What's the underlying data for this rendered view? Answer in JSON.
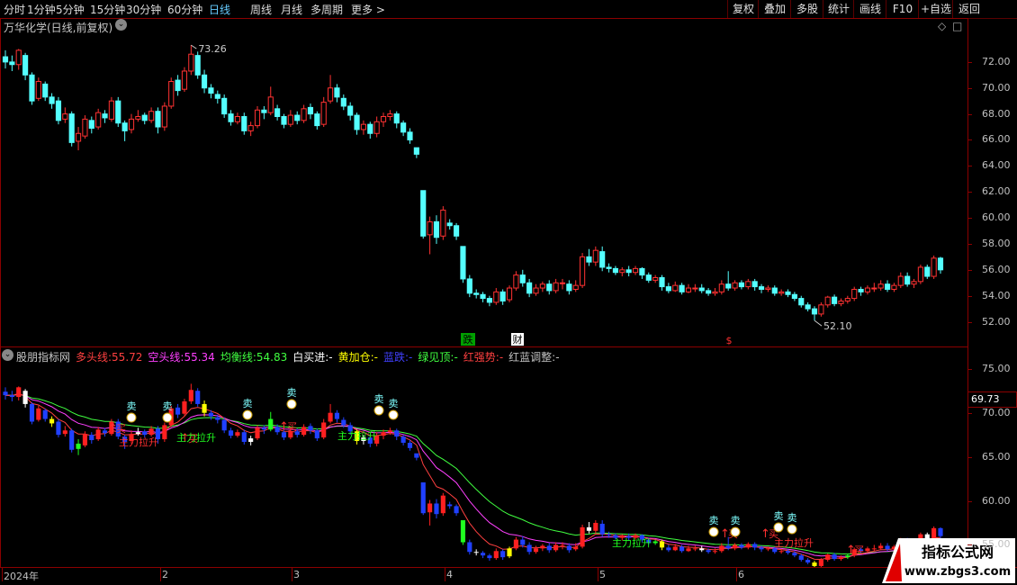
{
  "toolbar": {
    "periods": [
      "分时",
      "1分钟",
      "5分钟",
      "15分钟",
      "30分钟",
      "60分钟",
      "日线",
      "周线",
      "月线",
      "多周期",
      "更多 >"
    ],
    "active_period": "日线",
    "right_buttons": [
      "复权",
      "叠加",
      "多股",
      "统计",
      "画线",
      "F10",
      "+自选",
      "返回"
    ]
  },
  "main_title": "万华化学(日线,前复权)",
  "main_corner_icons": [
    "◇",
    "□"
  ],
  "main_markers": {
    "fall": "跌",
    "report": "财",
    "event": "$"
  },
  "high_label": "73.26",
  "low_label": "52.10",
  "price_badge": "69.73",
  "indicator": {
    "name": "股朋指标网",
    "legend": [
      {
        "label": "多头线:",
        "value": "55.72",
        "color": "#ff4040"
      },
      {
        "label": "空头线:",
        "value": "55.34",
        "color": "#ff40ff"
      },
      {
        "label": "均衡线:",
        "value": "54.83",
        "color": "#40ff40"
      },
      {
        "label": "白买进:",
        "value": "-",
        "color": "#ffffff"
      },
      {
        "label": "黄加仓:",
        "value": "-",
        "color": "#ffff00"
      },
      {
        "label": "蓝跌:",
        "value": "-",
        "color": "#4040ff"
      },
      {
        "label": "绿见顶:",
        "value": "-",
        "color": "#40ff40"
      },
      {
        "label": "红强势:",
        "value": "-",
        "color": "#ff4040"
      },
      {
        "label": "红蓝调整:",
        "value": "-",
        "color": "#c0c0c0"
      }
    ],
    "buy_label": "买",
    "sell_label": "卖",
    "surge_label": "主力拉升"
  },
  "watermark": {
    "title": "指标公式网",
    "url": "www.zbgs3.com"
  },
  "chart_data": [
    {
      "type": "candlestick",
      "title": "万华化学(日线,前复权)",
      "ylim": [
        51,
        74
      ],
      "yticks": [
        52,
        54,
        56,
        58,
        60,
        62,
        64,
        66,
        68,
        70,
        72
      ],
      "x_labels": [
        "2024年",
        "2",
        "3",
        "4",
        "5",
        "6"
      ],
      "candles": [
        [
          72.4,
          72.0,
          72.9,
          71.5
        ],
        [
          72.0,
          71.8,
          72.5,
          71.3
        ],
        [
          71.8,
          72.9,
          73.0,
          71.4
        ],
        [
          72.5,
          71.0,
          72.7,
          70.6
        ],
        [
          71.0,
          69.0,
          71.2,
          68.7
        ],
        [
          69.2,
          70.5,
          70.8,
          69.0
        ],
        [
          70.3,
          69.3,
          70.5,
          69.0
        ],
        [
          69.3,
          68.8,
          69.6,
          68.4
        ],
        [
          69.0,
          67.5,
          69.3,
          67.2
        ],
        [
          67.6,
          68.0,
          68.5,
          67.3
        ],
        [
          68.0,
          65.8,
          68.2,
          65.5
        ],
        [
          65.9,
          66.5,
          67.0,
          65.2
        ],
        [
          66.3,
          67.6,
          67.9,
          66.1
        ],
        [
          67.5,
          66.9,
          67.8,
          66.5
        ],
        [
          67.0,
          68.1,
          68.4,
          66.8
        ],
        [
          68.0,
          67.7,
          68.3,
          67.3
        ],
        [
          67.6,
          69.0,
          69.3,
          67.4
        ],
        [
          69.0,
          67.3,
          69.3,
          67.0
        ],
        [
          67.3,
          66.7,
          67.5,
          65.9
        ],
        [
          66.8,
          67.6,
          68.0,
          66.5
        ],
        [
          67.6,
          67.8,
          68.3,
          67.4
        ],
        [
          67.9,
          67.5,
          68.1,
          67.2
        ],
        [
          67.5,
          68.2,
          68.5,
          67.3
        ],
        [
          68.2,
          67.0,
          68.5,
          66.5
        ],
        [
          67.0,
          68.6,
          68.9,
          66.7
        ],
        [
          68.6,
          70.5,
          70.8,
          68.4
        ],
        [
          70.6,
          69.8,
          71.0,
          69.4
        ],
        [
          69.9,
          71.3,
          71.6,
          69.7
        ],
        [
          71.3,
          72.6,
          73.3,
          71.0
        ],
        [
          72.5,
          71.0,
          72.8,
          70.7
        ],
        [
          71.0,
          70.0,
          71.4,
          69.6
        ],
        [
          70.0,
          69.6,
          70.3,
          69.2
        ],
        [
          69.5,
          69.2,
          69.8,
          68.8
        ],
        [
          69.2,
          68.0,
          69.5,
          67.7
        ],
        [
          68.0,
          67.4,
          68.3,
          67.1
        ],
        [
          67.4,
          67.8,
          68.1,
          67.2
        ],
        [
          67.8,
          66.7,
          68.1,
          66.4
        ],
        [
          66.7,
          67.1,
          67.4,
          66.3
        ],
        [
          67.1,
          68.3,
          68.6,
          66.9
        ],
        [
          68.3,
          68.1,
          68.6,
          67.6
        ],
        [
          68.1,
          69.3,
          70.1,
          67.9
        ],
        [
          68.4,
          67.8,
          68.7,
          67.5
        ],
        [
          67.8,
          67.2,
          68.0,
          66.9
        ],
        [
          67.2,
          67.9,
          68.3,
          67.0
        ],
        [
          67.9,
          67.5,
          68.2,
          67.2
        ],
        [
          67.5,
          68.4,
          68.7,
          67.3
        ],
        [
          68.5,
          68.0,
          68.8,
          67.6
        ],
        [
          68.0,
          67.1,
          68.2,
          66.8
        ],
        [
          67.2,
          68.9,
          69.3,
          67.0
        ],
        [
          69.0,
          70.0,
          71.0,
          68.8
        ],
        [
          70.0,
          69.3,
          70.3,
          68.9
        ],
        [
          69.2,
          68.6,
          69.5,
          68.3
        ],
        [
          68.6,
          67.9,
          68.9,
          67.5
        ],
        [
          67.9,
          66.8,
          68.1,
          66.4
        ],
        [
          66.8,
          67.2,
          67.5,
          66.4
        ],
        [
          67.2,
          66.5,
          67.4,
          66.1
        ],
        [
          66.5,
          67.4,
          67.8,
          66.2
        ],
        [
          67.4,
          67.8,
          68.1,
          67.0
        ],
        [
          67.8,
          68.0,
          68.3,
          67.5
        ],
        [
          68.0,
          67.3,
          68.2,
          66.9
        ],
        [
          67.3,
          66.6,
          67.5,
          66.3
        ],
        [
          66.6,
          66.0,
          66.9,
          65.7
        ],
        [
          65.4,
          64.9,
          65.3,
          64.6
        ],
        [
          62.1,
          58.6,
          62.1,
          58.4
        ],
        [
          58.7,
          59.7,
          60.1,
          57.2
        ],
        [
          59.7,
          58.5,
          60.2,
          58.0
        ],
        [
          58.6,
          60.6,
          60.9,
          58.3
        ],
        [
          59.6,
          59.4,
          59.9,
          59.1
        ],
        [
          59.4,
          58.6,
          59.6,
          58.3
        ],
        [
          57.8,
          55.3,
          57.8,
          55.0
        ],
        [
          55.3,
          54.2,
          55.6,
          53.9
        ],
        [
          54.2,
          54.1,
          54.5,
          53.8
        ],
        [
          54.1,
          53.8,
          54.3,
          53.5
        ],
        [
          53.8,
          53.5,
          54.0,
          53.2
        ],
        [
          53.5,
          54.3,
          54.6,
          53.3
        ],
        [
          54.3,
          53.6,
          54.5,
          53.3
        ],
        [
          53.7,
          54.6,
          54.8,
          53.5
        ],
        [
          54.6,
          55.6,
          55.9,
          54.4
        ],
        [
          55.6,
          55.0,
          56.0,
          54.7
        ],
        [
          55.0,
          54.2,
          55.3,
          53.9
        ],
        [
          54.2,
          54.6,
          54.9,
          54.0
        ],
        [
          54.6,
          54.9,
          55.1,
          54.3
        ],
        [
          54.9,
          54.4,
          55.2,
          54.1
        ],
        [
          54.4,
          55.0,
          55.3,
          54.2
        ],
        [
          55.0,
          55.0,
          55.3,
          54.5
        ],
        [
          54.9,
          54.4,
          55.2,
          54.1
        ],
        [
          54.5,
          54.8,
          55.2,
          54.3
        ],
        [
          54.8,
          57.0,
          57.3,
          54.6
        ],
        [
          57.0,
          56.6,
          57.6,
          56.3
        ],
        [
          56.6,
          57.5,
          57.8,
          56.3
        ],
        [
          57.4,
          56.2,
          57.8,
          55.9
        ],
        [
          56.2,
          56.1,
          56.5,
          55.8
        ],
        [
          56.1,
          55.8,
          56.3,
          55.6
        ],
        [
          55.8,
          56.0,
          56.2,
          55.5
        ],
        [
          56.0,
          55.8,
          56.3,
          55.5
        ],
        [
          55.8,
          56.1,
          56.3,
          55.6
        ],
        [
          56.1,
          55.6,
          56.2,
          55.3
        ],
        [
          55.6,
          55.2,
          55.8,
          55.0
        ],
        [
          55.2,
          55.4,
          55.6,
          55.0
        ],
        [
          55.4,
          54.7,
          55.6,
          54.4
        ],
        [
          54.7,
          54.4,
          55.0,
          54.2
        ],
        [
          54.4,
          54.8,
          55.1,
          54.3
        ],
        [
          54.8,
          54.3,
          55.0,
          54.1
        ],
        [
          54.3,
          54.6,
          54.9,
          54.2
        ],
        [
          54.6,
          54.6,
          54.9,
          54.3
        ],
        [
          54.6,
          54.4,
          54.9,
          54.2
        ],
        [
          54.4,
          54.2,
          54.6,
          54.0
        ],
        [
          54.2,
          54.3,
          54.6,
          54.0
        ],
        [
          54.3,
          54.9,
          55.2,
          54.1
        ],
        [
          54.9,
          54.6,
          55.9,
          54.4
        ],
        [
          54.6,
          55.0,
          55.2,
          54.4
        ],
        [
          55.0,
          54.7,
          55.2,
          54.5
        ],
        [
          54.7,
          55.1,
          55.3,
          54.5
        ],
        [
          55.1,
          54.7,
          55.3,
          54.4
        ],
        [
          54.7,
          54.5,
          54.9,
          54.2
        ],
        [
          54.5,
          54.6,
          54.8,
          54.3
        ],
        [
          54.6,
          54.2,
          54.8,
          54.0
        ],
        [
          54.2,
          54.3,
          54.5,
          54.0
        ],
        [
          54.3,
          54.1,
          54.5,
          53.9
        ],
        [
          54.1,
          53.8,
          54.3,
          53.6
        ],
        [
          53.8,
          53.3,
          54.0,
          53.1
        ],
        [
          53.3,
          53.0,
          53.5,
          52.8
        ],
        [
          53.0,
          52.6,
          53.2,
          52.1
        ],
        [
          52.6,
          53.3,
          53.5,
          52.4
        ],
        [
          53.3,
          53.9,
          54.0,
          53.1
        ],
        [
          53.9,
          53.4,
          54.1,
          53.2
        ],
        [
          53.4,
          53.6,
          53.8,
          53.2
        ],
        [
          53.6,
          53.8,
          54.0,
          53.4
        ],
        [
          53.8,
          54.5,
          54.7,
          53.6
        ],
        [
          54.5,
          54.3,
          54.7,
          54.0
        ],
        [
          54.3,
          54.6,
          54.8,
          54.1
        ],
        [
          54.6,
          54.6,
          55.0,
          54.3
        ],
        [
          54.6,
          54.9,
          55.2,
          54.4
        ],
        [
          54.9,
          54.5,
          55.2,
          54.3
        ],
        [
          54.5,
          54.8,
          55.0,
          54.3
        ],
        [
          54.8,
          55.5,
          55.8,
          54.6
        ],
        [
          55.5,
          54.9,
          55.8,
          54.7
        ],
        [
          54.9,
          55.1,
          55.3,
          54.6
        ],
        [
          55.1,
          56.2,
          56.4,
          54.9
        ],
        [
          56.2,
          55.5,
          56.4,
          55.3
        ],
        [
          55.5,
          56.9,
          57.1,
          55.3
        ],
        [
          56.9,
          56.0,
          57.0,
          55.7
        ]
      ]
    },
    {
      "type": "line",
      "title": "股朋指标网",
      "ylim": [
        53,
        76
      ],
      "yticks": [
        55.0,
        60.0,
        65.0,
        70.0,
        75.0
      ],
      "series": [
        {
          "name": "多头线",
          "color": "#ff4040",
          "last": 55.72
        },
        {
          "name": "空头线",
          "color": "#ff40ff",
          "last": 55.34
        },
        {
          "name": "均衡线",
          "color": "#40ff40",
          "last": 54.83
        }
      ]
    }
  ]
}
